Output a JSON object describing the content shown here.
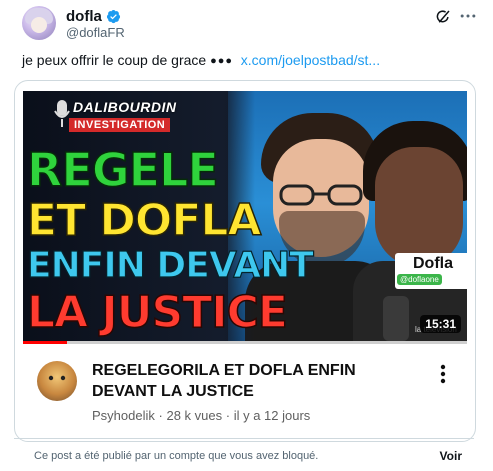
{
  "author": {
    "name": "dofla",
    "handle": "@doflaFR",
    "verified": true
  },
  "tweet": {
    "text": "je peux offrir le coup de grace",
    "dots": "●●●",
    "link": "x.com/joelpostbad/st..."
  },
  "video": {
    "thumbnail": {
      "brand_top": "DALIBOURDIN",
      "brand_bottom": "INVESTIGATION",
      "line1": "REGELE",
      "line2": "ET DOFLA",
      "line3": "ENFIN DEVANT",
      "line4": "LA JUSTICE",
      "mic_tag": "Dofla",
      "mic_handle": "@doflaone",
      "watermark": "la télévision",
      "duration": "15:31"
    },
    "progress_fraction": 0.1,
    "title": "REGELEGORILA ET DOFLA ENFIN DEVANT LA JUSTICE",
    "channel": "Psyhodelik",
    "views": "28 k vues",
    "age": "il y a 12 jours",
    "separator": "·"
  },
  "blocked_notice": {
    "text": "Ce post a été publié par un compte que vous avez bloqué.",
    "action": "Voir"
  },
  "colors": {
    "link": "#1d9bf0",
    "verified": "#1d9bf0",
    "progress": "#ff0000"
  },
  "icons": {
    "verified": "verified-badge-icon",
    "grok": "grok-icon",
    "more": "more-icon",
    "kebab": "kebab-menu-icon"
  }
}
